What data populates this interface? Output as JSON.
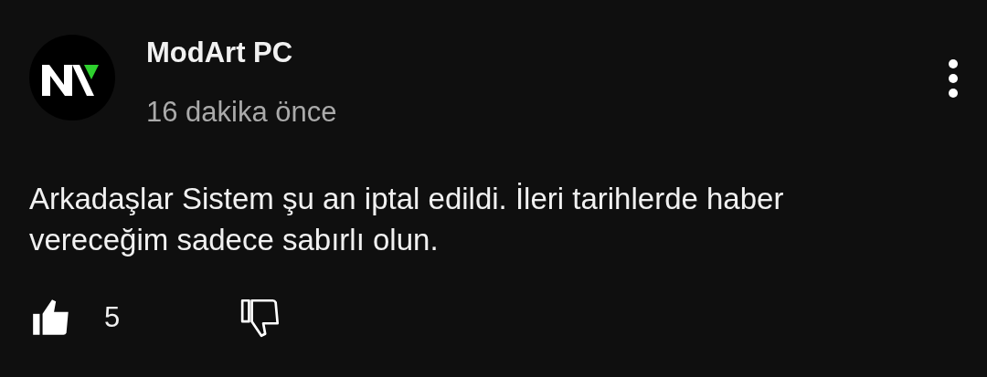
{
  "comment": {
    "author": "ModArt PC",
    "time": "16 dakika önce",
    "text": "Arkadaşlar Sistem şu an iptal edildi. İleri tarihlerde haber vereceğim sadece sabırlı olun.",
    "liked": true,
    "like_count": "5",
    "disliked": false
  }
}
